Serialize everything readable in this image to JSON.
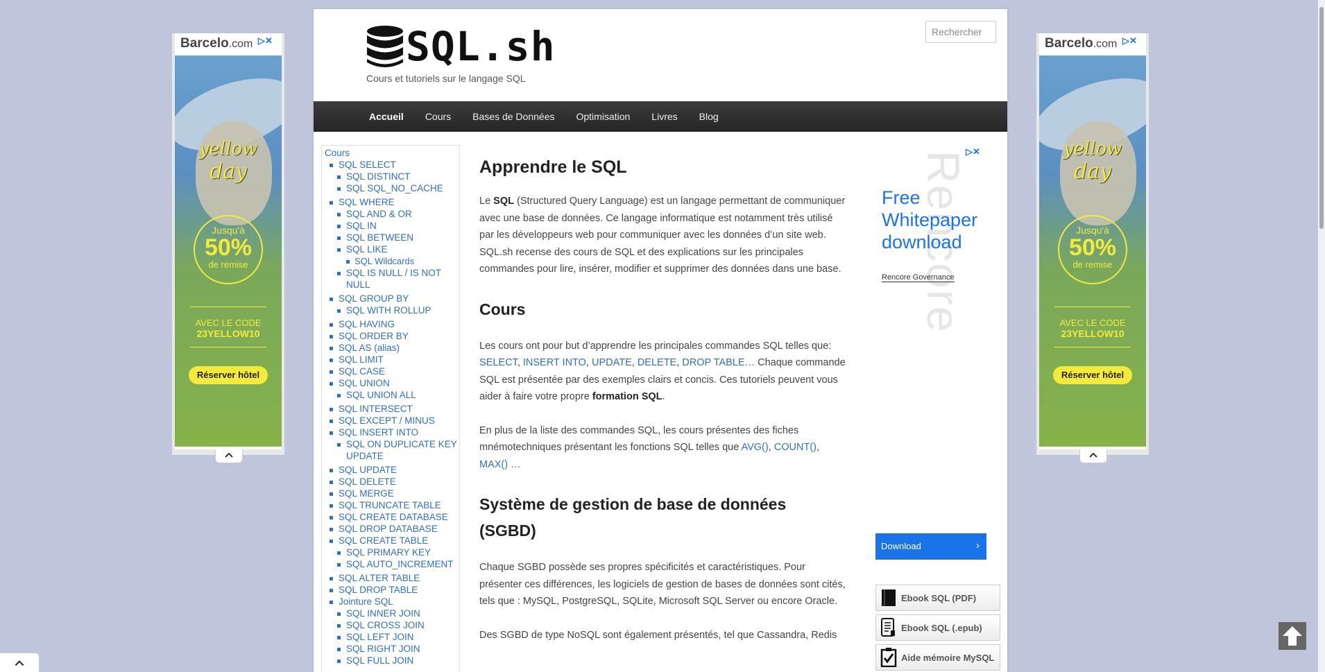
{
  "site": {
    "logo_text": "SQL.sh",
    "tagline": "Cours et tutoriels sur le langage SQL"
  },
  "search": {
    "placeholder": "Rechercher"
  },
  "nav": [
    "Accueil",
    "Cours",
    "Bases de Données",
    "Optimisation",
    "Livres",
    "Blog"
  ],
  "sidebar": {
    "root": "Cours",
    "items": [
      {
        "label": "SQL SELECT",
        "level": 1
      },
      {
        "label": "SQL DISTINCT",
        "level": 2
      },
      {
        "label": "SQL SQL_NO_CACHE",
        "level": 2
      },
      {
        "label": "SQL WHERE",
        "level": 1,
        "gap": true
      },
      {
        "label": "SQL AND & OR",
        "level": 2
      },
      {
        "label": "SQL IN",
        "level": 2
      },
      {
        "label": "SQL BETWEEN",
        "level": 2
      },
      {
        "label": "SQL LIKE",
        "level": 2
      },
      {
        "label": "SQL Wildcards",
        "level": 3
      },
      {
        "label": "SQL IS NULL / IS NOT NULL",
        "level": 2
      },
      {
        "label": "SQL GROUP BY",
        "level": 1,
        "gap": true
      },
      {
        "label": "SQL WITH ROLLUP",
        "level": 2
      },
      {
        "label": "SQL HAVING",
        "level": 1,
        "gap": true
      },
      {
        "label": "SQL ORDER BY",
        "level": 1
      },
      {
        "label": "SQL AS (alias)",
        "level": 1
      },
      {
        "label": "SQL LIMIT",
        "level": 1
      },
      {
        "label": "SQL CASE",
        "level": 1
      },
      {
        "label": "SQL UNION",
        "level": 1
      },
      {
        "label": "SQL UNION ALL",
        "level": 2
      },
      {
        "label": "SQL INTERSECT",
        "level": 1,
        "gap": true
      },
      {
        "label": "SQL EXCEPT / MINUS",
        "level": 1
      },
      {
        "label": "SQL INSERT INTO",
        "level": 1
      },
      {
        "label": "SQL ON DUPLICATE KEY UPDATE",
        "level": 2
      },
      {
        "label": "SQL UPDATE",
        "level": 1,
        "gap": true
      },
      {
        "label": "SQL DELETE",
        "level": 1
      },
      {
        "label": "SQL MERGE",
        "level": 1
      },
      {
        "label": "SQL TRUNCATE TABLE",
        "level": 1
      },
      {
        "label": "SQL CREATE DATABASE",
        "level": 1
      },
      {
        "label": "SQL DROP DATABASE",
        "level": 1
      },
      {
        "label": "SQL CREATE TABLE",
        "level": 1
      },
      {
        "label": "SQL PRIMARY KEY",
        "level": 2
      },
      {
        "label": "SQL AUTO_INCREMENT",
        "level": 2
      },
      {
        "label": "SQL ALTER TABLE",
        "level": 1,
        "gap": true
      },
      {
        "label": "SQL DROP TABLE",
        "level": 1
      },
      {
        "label": "Jointure SQL",
        "level": 1
      },
      {
        "label": "SQL INNER JOIN",
        "level": 2
      },
      {
        "label": "SQL CROSS JOIN",
        "level": 2
      },
      {
        "label": "SQL LEFT JOIN",
        "level": 2
      },
      {
        "label": "SQL RIGHT JOIN",
        "level": 2
      },
      {
        "label": "SQL FULL JOIN",
        "level": 2
      }
    ]
  },
  "content": {
    "h1": "Apprendre le SQL",
    "intro": [
      {
        "t": "Le "
      },
      {
        "t": "SQL",
        "b": true
      },
      {
        "t": " (Structured Query Language) est un langage permettant de communiquer avec une base de données. Ce langage informatique est notamment très utilisé par les développeurs web pour communiquer avec les données d’un site web. SQL.sh recense des cours de SQL et des explications sur les principales commandes pour lire, insérer, modifier et supprimer des données dans une base."
      }
    ],
    "h2_cours": "Cours",
    "cours_p1": [
      {
        "t": "Les cours ont pour but d’apprendre les principales commandes SQL telles que: "
      },
      {
        "t": "SELECT",
        "a": true
      },
      {
        "t": ", "
      },
      {
        "t": "INSERT INTO",
        "a": true
      },
      {
        "t": ", "
      },
      {
        "t": "UPDATE",
        "a": true
      },
      {
        "t": ", "
      },
      {
        "t": "DELETE",
        "a": true
      },
      {
        "t": ", "
      },
      {
        "t": "DROP TABLE",
        "a": true
      },
      {
        "t": "…",
        "a": true
      },
      {
        "t": " Chaque commande SQL est présentée par des exemples clairs et concis. Ces tutoriels peuvent vous aider à faire votre propre "
      },
      {
        "t": "formation SQL",
        "b": true
      },
      {
        "t": "."
      }
    ],
    "cours_p2": [
      {
        "t": "En plus de la liste des commandes SQL, les cours présentes des fiches mnémotechniques présentant les fonctions SQL telles que "
      },
      {
        "t": "AVG()",
        "a": true
      },
      {
        "t": ", "
      },
      {
        "t": "COUNT()",
        "a": true
      },
      {
        "t": ", "
      },
      {
        "t": "MAX()",
        "a": true
      },
      {
        "t": " …",
        "a": true
      }
    ],
    "h2_sgbd": "Système de gestion de base de données (SGBD)",
    "sgbd_p1": "Chaque SGBD possède ses propres spécificités et caractéristiques. Pour présenter ces différences, les logiciels de gestion de bases de données sont cités, tels que : MySQL, PostgreSQL, SQLite, Microsoft SQL Server ou encore Oracle.",
    "sgbd_p2": "Des SGBD de type NoSQL sont également présentés, tel que Cassandra, Redis"
  },
  "ad_right": {
    "watermark": "Rencore",
    "headline": "Free Whitepaper download",
    "sub": "Rencore Governance",
    "button": "Download"
  },
  "ebooks": [
    "Ebook SQL (PDF)",
    "Ebook SQL (.epub)",
    "Aide mémoire MySQL"
  ],
  "banner": {
    "brand": "Barcelo",
    "brand_suffix": ".com",
    "line1": "yellow",
    "line2": "day",
    "up_to": "Jusqu'à",
    "percent": "50%",
    "off": "de remise",
    "code_label": "AVEC LE CODE",
    "code": "23YELLOW10",
    "cta": "Réserver hôtel"
  },
  "colors": {
    "link": "#2e6fbf",
    "nav_bg": "#2f2f2f",
    "ad_blue": "#1a73e8",
    "banner_yellow": "#f3ea3a",
    "page_bg": "#bfc6db"
  }
}
